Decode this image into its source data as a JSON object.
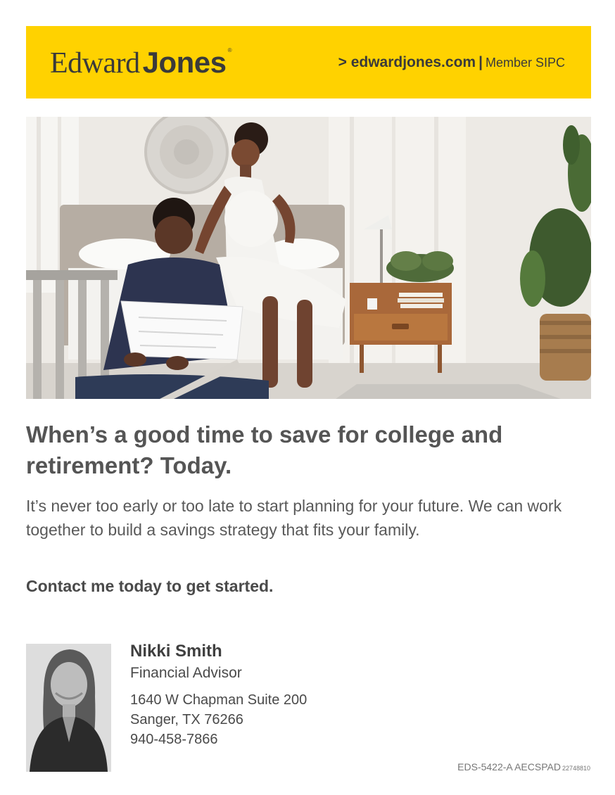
{
  "header": {
    "logo_word_1": "Edward",
    "logo_word_2": "Jones",
    "logo_reg": "®",
    "site_link": "> edwardjones.com",
    "separator": "|",
    "member": "Member SIPC"
  },
  "main": {
    "headline": "When’s a good time to save for college and retirement? Today.",
    "body": "It’s never too early or too late to start planning for your future. We can work together to build a savings strategy that fits your family.",
    "cta": "Contact me today to get started."
  },
  "advisor": {
    "name": "Nikki Smith",
    "title": "Financial Advisor",
    "address_line_1": "1640 W Chapman Suite 200",
    "address_line_2": "Sanger, TX 76266",
    "phone": "940-458-7866"
  },
  "footer": {
    "code": "EDS-5422-A AECSPAD",
    "code_small": "22748810"
  },
  "colors": {
    "brand_yellow": "#FFD200",
    "text_gray": "#555555"
  }
}
